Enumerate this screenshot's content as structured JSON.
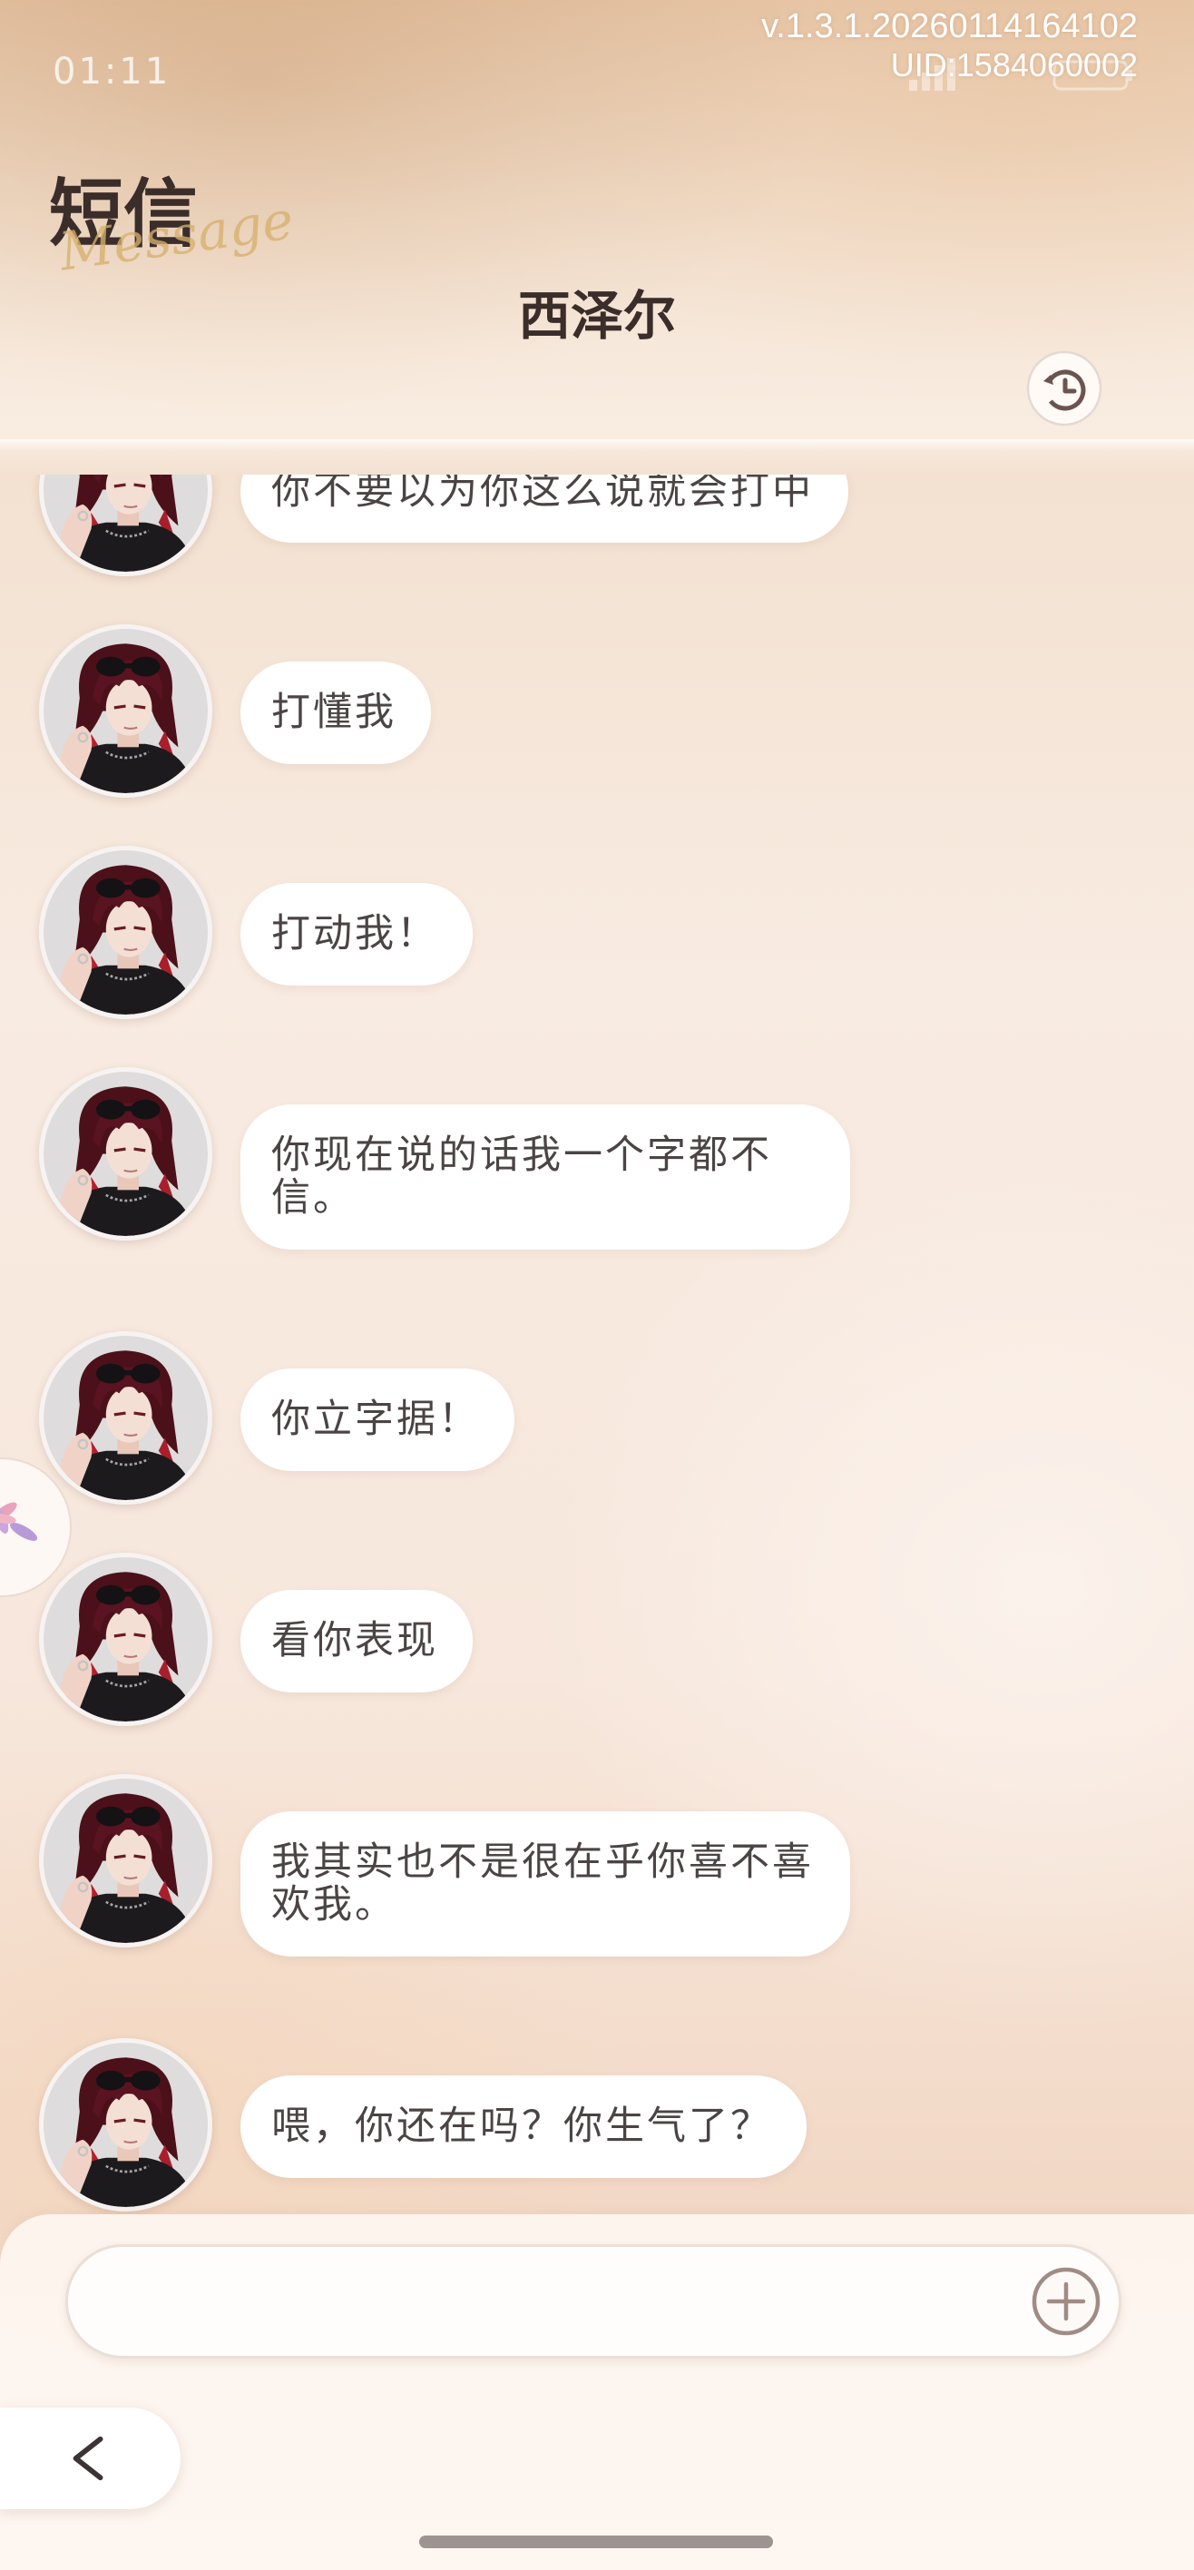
{
  "status_bar": {
    "time": "01:11",
    "version": "v.1.3.1.20260114164102",
    "uid": "UID:1584060002",
    "icons": [
      "signal-icon",
      "battery-icon"
    ]
  },
  "header": {
    "title": "短信",
    "title_script": "Message",
    "contact_name": "西泽尔",
    "history_icon": "clock-history-icon"
  },
  "messages": [
    {
      "text": "你不要以为你这么说就会打中"
    },
    {
      "text": "打懂我"
    },
    {
      "text": "打动我！"
    },
    {
      "text": "你现在说的话我一个字都不信。"
    },
    {
      "text": "你立字据！"
    },
    {
      "text": "看你表现"
    },
    {
      "text": "我其实也不是很在乎你喜不喜欢我。"
    },
    {
      "text": "喂，你还在吗？你生气了？"
    }
  ],
  "composer": {
    "value": "",
    "placeholder": "",
    "add_icon": "plus-circle-icon"
  },
  "navigation": {
    "back_icon": "chevron-left-icon"
  },
  "side_widget": {
    "icon": "pinwheel-icon"
  },
  "colors": {
    "bubble": "#ffffff",
    "message_text": "#4b4444",
    "title": "#3a2d2a",
    "script_gold": "#d6b06c",
    "hair_red": "#5a1320"
  }
}
